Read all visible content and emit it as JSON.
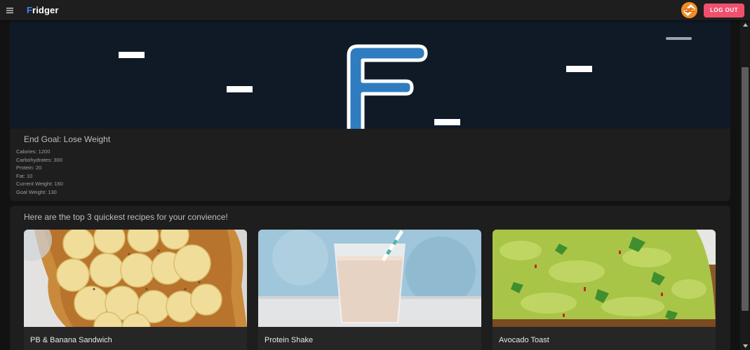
{
  "appbar": {
    "brand_first": "F",
    "brand_rest": "ridger",
    "menu_icon": "hamburger-menu-icon",
    "logout_label": "LOG OUT",
    "accent": "#3a82f7",
    "logout_color": "#f0506e"
  },
  "goal": {
    "title": "End Goal: Lose Weight",
    "stats": [
      "Calories: 1200",
      "Carbohydrates: 300",
      "Protein: 20",
      "Fat: 10",
      "Current Weight: 160",
      "Goal Weight: 130"
    ]
  },
  "recipes": {
    "heading": "Here are the top 3 quickest recipes for your convience!",
    "items": [
      {
        "name": "PB & Banana Sandwich"
      },
      {
        "name": "Protein Shake"
      },
      {
        "name": "Avocado Toast"
      }
    ]
  }
}
